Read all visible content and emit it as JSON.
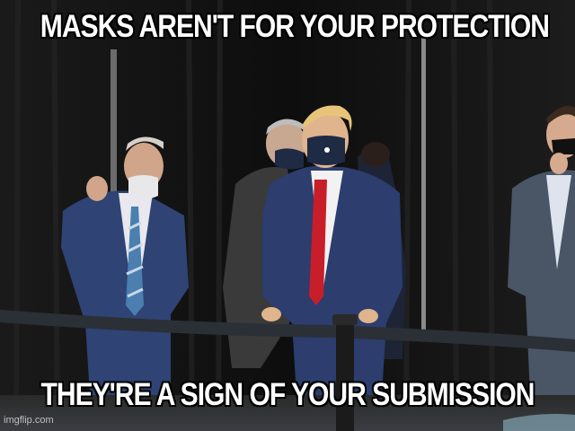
{
  "meme": {
    "top_text": "MASKS AREN'T FOR YOUR PROTECTION",
    "bottom_text": "THEY'RE A SIGN OF YOUR SUBMISSION",
    "watermark": "imgflip.com"
  },
  "colors": {
    "curtain": "#151515",
    "suit_navy": "#2c3d6e",
    "tie_red": "#c81e2a",
    "mask_navy": "#1f2a45",
    "mask_white": "#e8e8ea",
    "caption_text": "#ffffff"
  }
}
